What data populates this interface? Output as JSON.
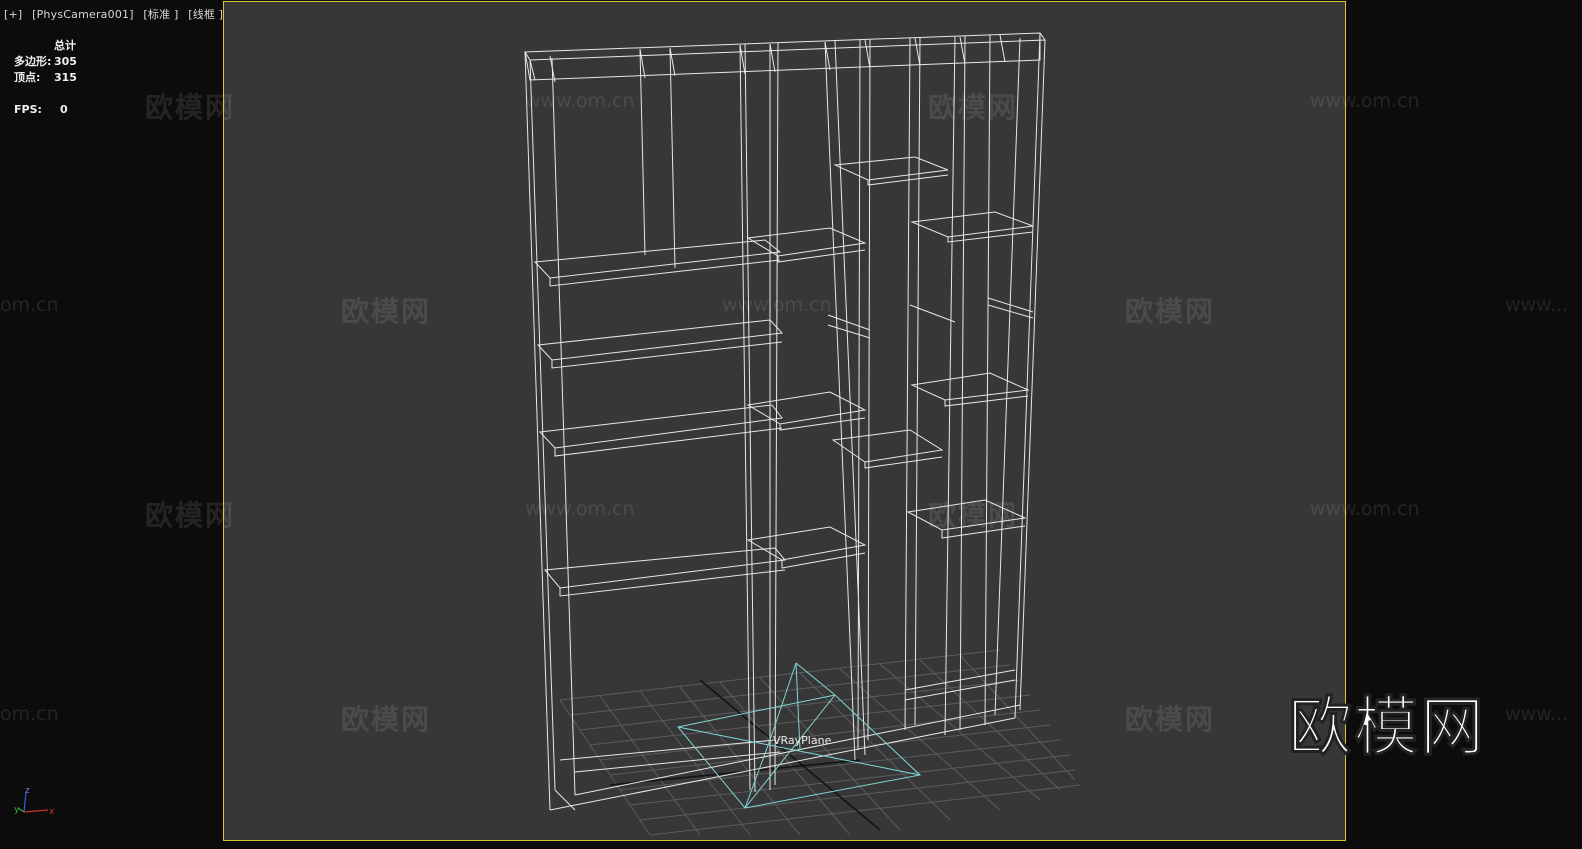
{
  "viewport": {
    "label_plus": "[+]",
    "label_camera": "[PhysCamera001]",
    "label_shading": "[标准 ]",
    "label_mode": "[线框 ]"
  },
  "stats": {
    "header": "总计",
    "polygons_label": "多边形:",
    "polygons_value": "305",
    "vertices_label": "顶点:",
    "vertices_value": "315",
    "fps_label": "FPS:",
    "fps_value": "0"
  },
  "scene": {
    "object_label": "VRayPlane"
  },
  "watermarks": {
    "logo": "欧模网",
    "url": "www.om.cn",
    "url_short": "om.cn",
    "url_partial": "www..."
  },
  "brand_logo": "欧模网",
  "colors": {
    "viewport_bg": "#373737",
    "viewport_border": "#d8c436",
    "wire": "#e8e8e8",
    "plane_wire": "#7fd6d6",
    "grid": "#5a5a5a"
  },
  "axis_gizmo": {
    "x": "x",
    "y": "y",
    "z": "z"
  }
}
